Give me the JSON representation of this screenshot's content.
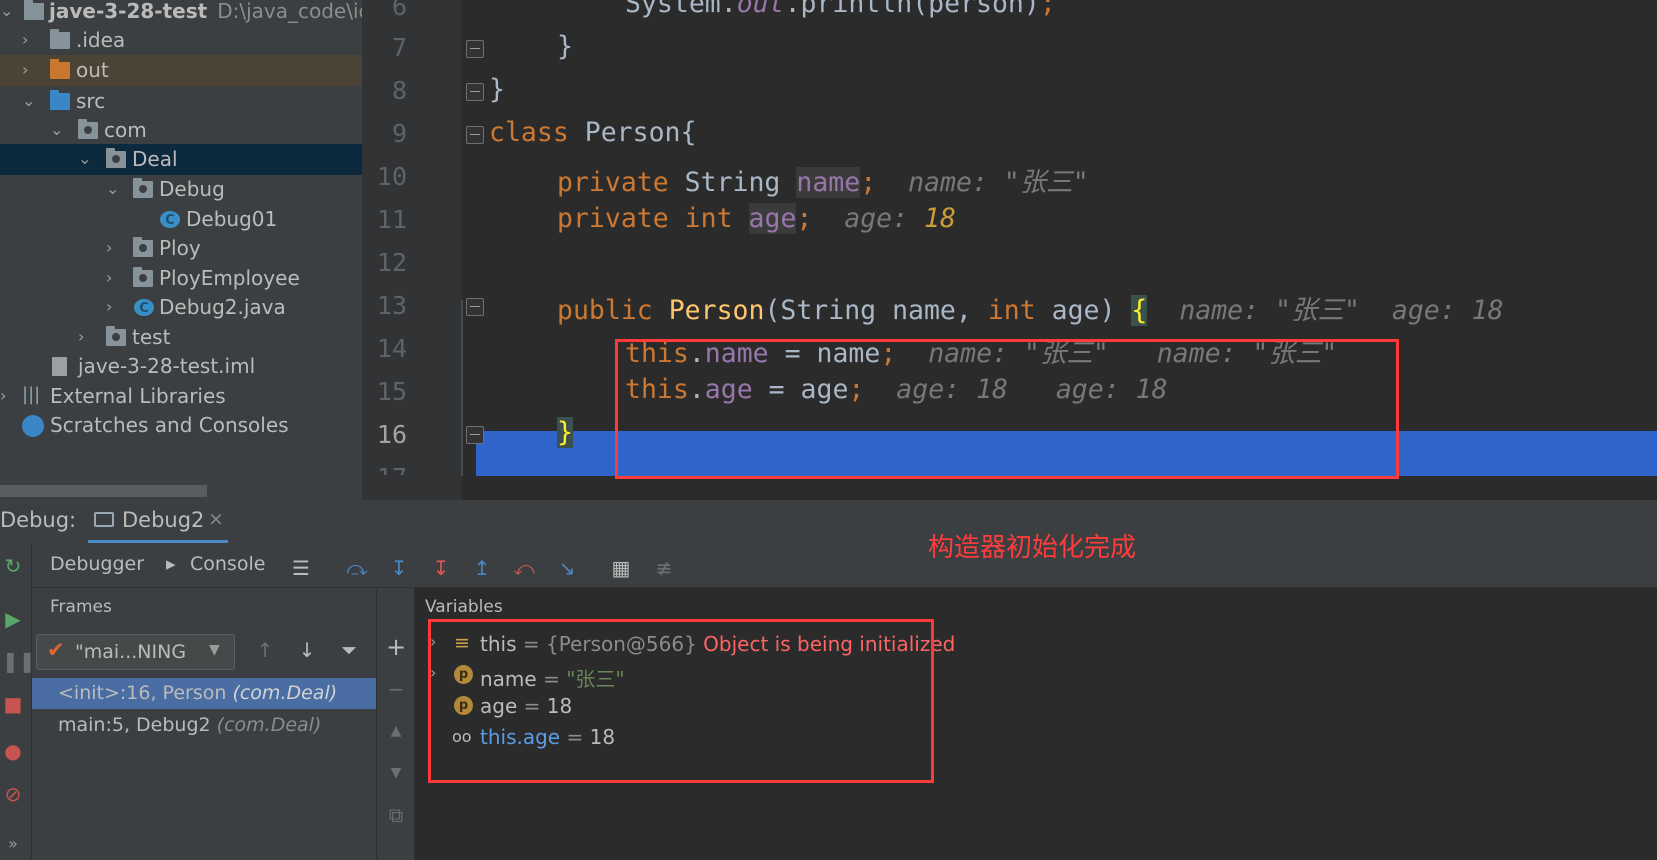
{
  "project": {
    "root_name": "jave-3-28-test",
    "root_path": "D:\\java_code\\ide",
    "items": [
      {
        "label": "jave-3-28-test"
      },
      {
        "label": ".idea"
      },
      {
        "label": "out"
      },
      {
        "label": "src"
      },
      {
        "label": "com"
      },
      {
        "label": "Deal"
      },
      {
        "label": "Debug"
      },
      {
        "label": "Debug01"
      },
      {
        "label": "Ploy"
      },
      {
        "label": "PloyEmployee"
      },
      {
        "label": "Debug2.java"
      },
      {
        "label": "test"
      },
      {
        "label": "jave-3-28-test.iml"
      },
      {
        "label": "External Libraries"
      },
      {
        "label": "Scratches and Consoles"
      }
    ]
  },
  "editor": {
    "line_numbers": [
      "6",
      "7",
      "8",
      "9",
      "10",
      "11",
      "12",
      "13",
      "14",
      "15",
      "16",
      "17"
    ],
    "current_line": "16",
    "tokens": {
      "l6_code": "System.",
      "l6_out": "out",
      "l6_rest": ".println(person)",
      "l6_semi": ";",
      "l7": "}",
      "l8": "}",
      "class_kw": "class",
      "class_name": "Person{",
      "private_kw": "private",
      "string_type": "String",
      "name_field": "name",
      "semi": ";",
      "int_kw": "int",
      "age_field": "age",
      "public_kw": "public",
      "ctor_name": "Person",
      "ctor_params_a": "(String name, ",
      "ctor_params_b": " age) ",
      "open_brace": "{",
      "this_kw": "this",
      "dot": ".",
      "assign_name": " = name",
      "assign_age": " = age",
      "close_brace": "}"
    },
    "hints": {
      "l10": "name: \"张三\"",
      "l11_label": "age: ",
      "l11_value": "18",
      "l13_name": "name: \"张三\"",
      "l13_age": "age: 18",
      "l14": "name: \"张三\"   name: \"张三\"",
      "l15": "age: 18   age: 18"
    }
  },
  "debug": {
    "title": "Debug:",
    "tab_label": "Debug2",
    "tab_close": "×",
    "annotation": "构造器初始化完成",
    "subtabs": {
      "debugger": "Debugger",
      "console": "Console"
    },
    "frames_title": "Frames",
    "variables_title": "Variables",
    "thread": "\"mai...NING",
    "frames": [
      {
        "method": "<init>:16, Person",
        "pkg": "(com.Deal)"
      },
      {
        "method": "main:5, Debug2",
        "pkg": "(com.Deal)"
      }
    ],
    "variables": [
      {
        "name": "this",
        "eq": " = ",
        "value": "{Person@566}",
        "note": " Object is being initialized"
      },
      {
        "name": "name",
        "eq": " = ",
        "value": "\"张三\""
      },
      {
        "name": "age",
        "eq": " = ",
        "value": "18"
      },
      {
        "name": "this.age",
        "eq": " = ",
        "value": "18"
      }
    ]
  },
  "colors": {
    "keyword": "#cc7832",
    "field": "#9876aa",
    "method": "#ffc66d",
    "execution_line": "#2f65ca",
    "annotation": "#ff3c3c"
  }
}
